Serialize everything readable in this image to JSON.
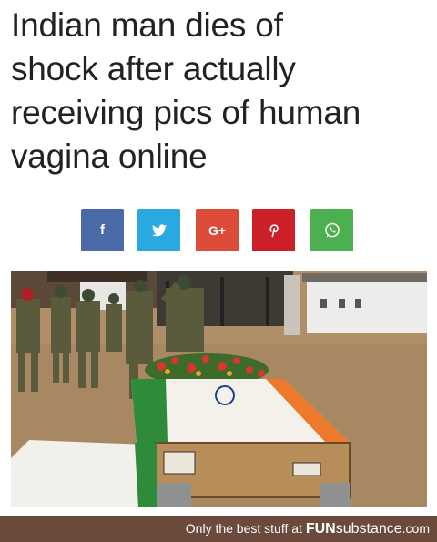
{
  "headline": {
    "lines": [
      "Indian man dies of",
      "shock after actually",
      "receiving pics of human",
      "vagina online"
    ]
  },
  "share_buttons": [
    {
      "network": "facebook",
      "icon": "facebook-icon",
      "glyph": "f",
      "color": "#4a6aa8"
    },
    {
      "network": "twitter",
      "icon": "twitter-icon",
      "glyph": "",
      "color": "#2aa9e0"
    },
    {
      "network": "google-plus",
      "icon": "google-plus-icon",
      "glyph": "G+",
      "color": "#dd4b39"
    },
    {
      "network": "pinterest",
      "icon": "pinterest-icon",
      "glyph": "P",
      "color": "#cb2027"
    },
    {
      "network": "whatsapp",
      "icon": "whatsapp-icon",
      "glyph": "",
      "color": "#4caf50"
    }
  ],
  "photo": {
    "subject": "soldiers saluting a flag-draped coffin with flowers"
  },
  "footer": {
    "prefix": "Only the best stuff at ",
    "brand_bold": "FUN",
    "brand_rest": "substance",
    "brand_tld": ".com",
    "background": "#6b4a3b"
  }
}
